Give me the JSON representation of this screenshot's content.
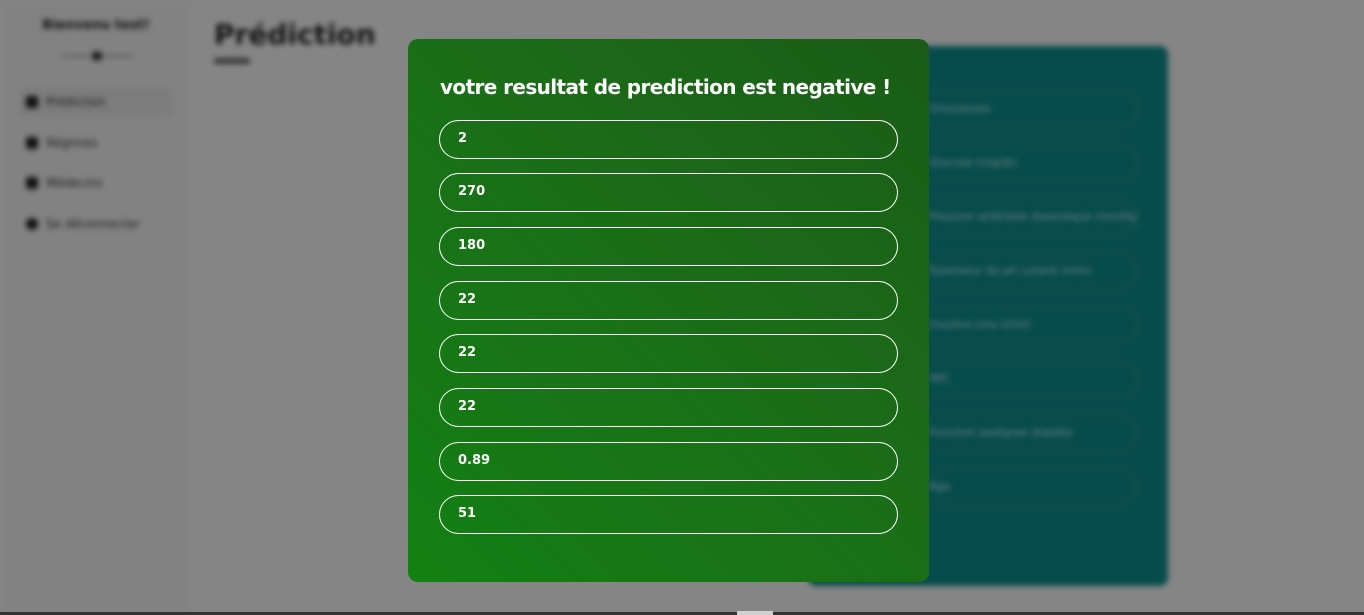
{
  "background": {
    "sidebar": {
      "title": "Bienvenu test!",
      "items": [
        {
          "label": "Prédiction",
          "icon": "search-icon"
        },
        {
          "label": "Régimes",
          "icon": "utensils-icon"
        },
        {
          "label": "Médecins",
          "icon": "user-icon"
        },
        {
          "label": "Se déconnecter",
          "icon": "logout-icon"
        }
      ]
    },
    "main": {
      "title": "Prédiction"
    },
    "form": {
      "fields": [
        "Grossesses",
        "Glucose (mg/dl)",
        "Pression artérielle diastolique (mmHg)",
        "Épaisseur du pli cutané (mm)",
        "Insuline (mu U/ml)",
        "IMC",
        "Fonction pedigree diabète",
        "Âge"
      ]
    }
  },
  "modal": {
    "title": "votre resultat de prediction est negative !",
    "values": [
      "2",
      "270",
      "180",
      "22",
      "22",
      "22",
      "0.89",
      "51"
    ]
  }
}
